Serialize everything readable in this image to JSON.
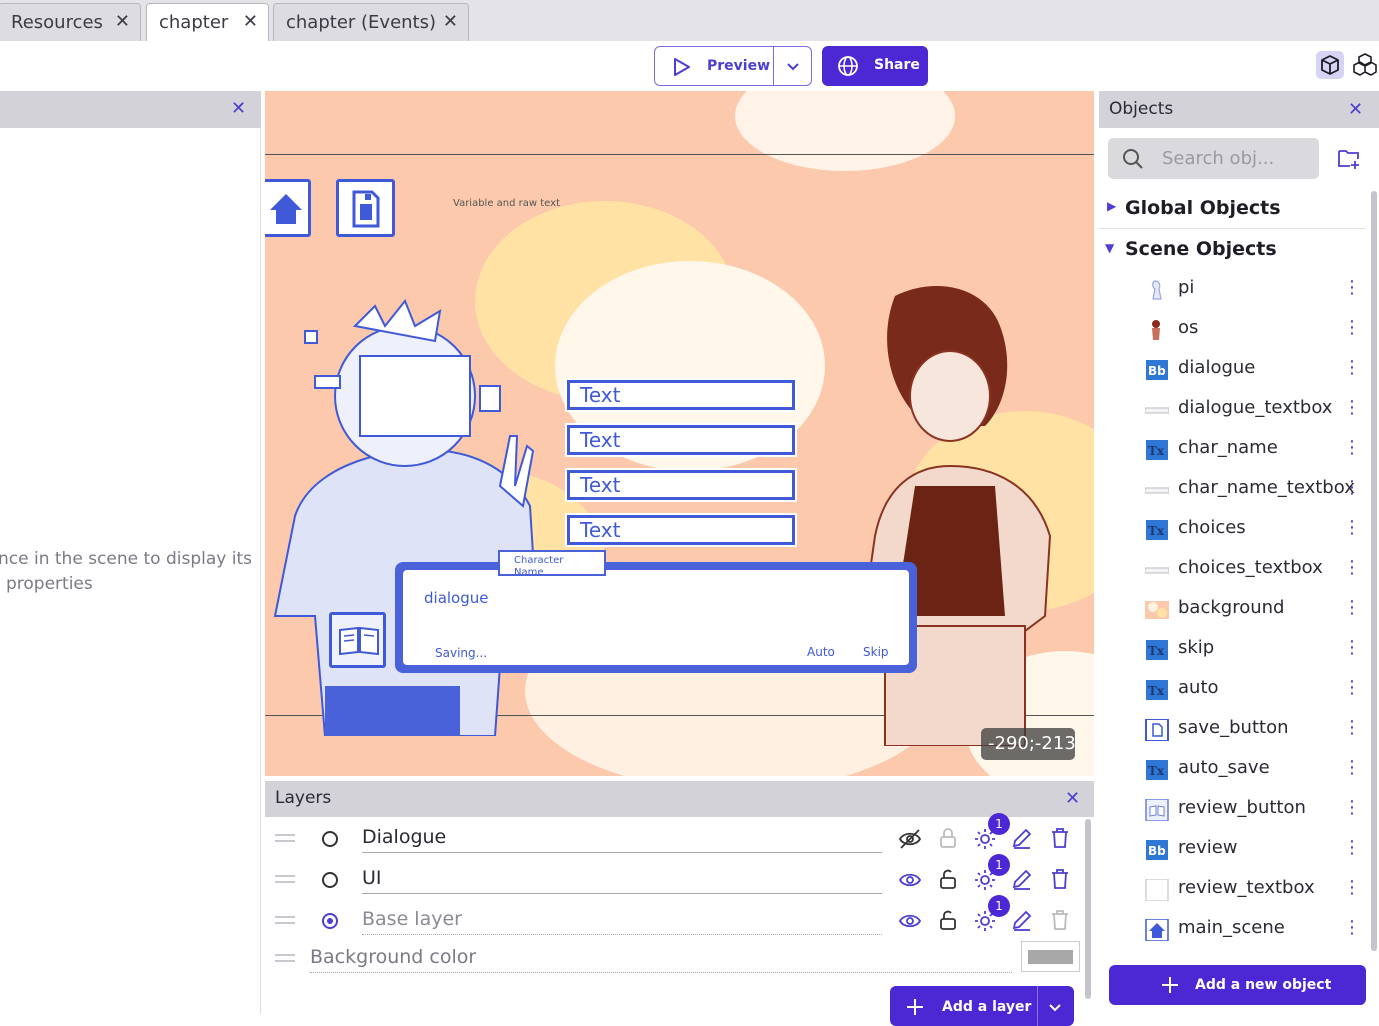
{
  "tabs": [
    {
      "label": "Resources"
    },
    {
      "label": "chapter"
    },
    {
      "label": "chapter (Events)"
    }
  ],
  "toolbar": {
    "preview_label": "Preview",
    "share_label": "Share"
  },
  "left_panel": {
    "hint_line1": "nce in the scene to display its",
    "hint_line2": "properties"
  },
  "scene": {
    "raw_text": "Variable and raw text",
    "choices": [
      "Text",
      "Text",
      "Text",
      "Text"
    ],
    "char_name": "Character Name",
    "dialogue": "dialogue",
    "saving": "Saving...",
    "auto": "Auto",
    "skip": "Skip",
    "coords": "-290;-213"
  },
  "layers": {
    "title": "Layers",
    "rows": [
      {
        "name": "Dialogue",
        "effects": "1"
      },
      {
        "name": "UI",
        "effects": "1"
      },
      {
        "name": "Base layer",
        "effects": "1"
      }
    ],
    "background_color_label": "Background color",
    "add_layer_label": "Add a layer"
  },
  "objects": {
    "title": "Objects",
    "search_placeholder": "Search obj...",
    "global_label": "Global Objects",
    "scene_label": "Scene Objects",
    "items": [
      {
        "name": "pi",
        "icon": "sprite-icon"
      },
      {
        "name": "os",
        "icon": "sprite-icon"
      },
      {
        "name": "dialogue",
        "icon": "bbtext-icon"
      },
      {
        "name": "dialogue_textbox",
        "icon": "textbox-icon"
      },
      {
        "name": "char_name",
        "icon": "text-icon"
      },
      {
        "name": "char_name_textbox",
        "icon": "textbox-icon"
      },
      {
        "name": "choices",
        "icon": "text-icon"
      },
      {
        "name": "choices_textbox",
        "icon": "textbox-icon"
      },
      {
        "name": "background",
        "icon": "image-icon"
      },
      {
        "name": "skip",
        "icon": "text-icon"
      },
      {
        "name": "auto",
        "icon": "text-icon"
      },
      {
        "name": "save_button",
        "icon": "save-icon"
      },
      {
        "name": "auto_save",
        "icon": "text-icon"
      },
      {
        "name": "review_button",
        "icon": "book-icon"
      },
      {
        "name": "review",
        "icon": "bbtext-icon"
      },
      {
        "name": "review_textbox",
        "icon": "panel-icon"
      },
      {
        "name": "main_scene",
        "icon": "home-icon"
      }
    ],
    "add_object_label": "Add a new object"
  },
  "colors": {
    "accent": "#4c27d4",
    "scene_bg": "#fcc9ad",
    "ui_blue": "#3f59d8"
  }
}
